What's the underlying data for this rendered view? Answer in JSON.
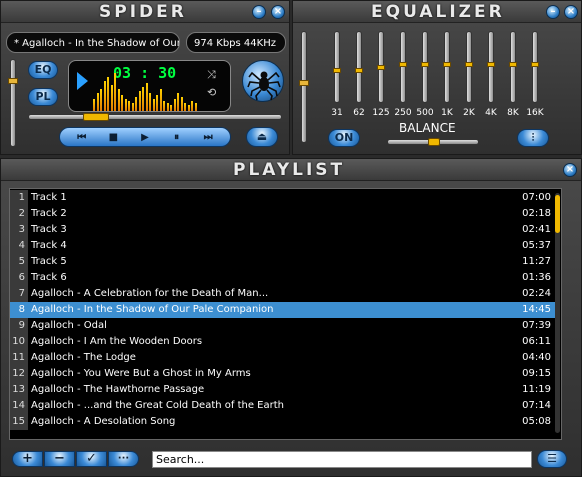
{
  "player": {
    "title": "SPIDER",
    "track_text": "* Agalloch - In the Shadow of Our",
    "bitrate": "974 Kbps 44KHz",
    "time": "03 : 30",
    "eq_button": "EQ",
    "pl_button": "PL",
    "seek_progress": 0.24,
    "volume_level": 0.78,
    "transport": {
      "prev": "⏮",
      "stop": "■",
      "play": "▶",
      "pause": "⏸",
      "next": "⏭",
      "eject": "⏏"
    },
    "spectrum": [
      12,
      18,
      22,
      30,
      34,
      26,
      38,
      22,
      16,
      12,
      10,
      8,
      14,
      20,
      24,
      28,
      18,
      12,
      16,
      22,
      10,
      8,
      6,
      12,
      18,
      14,
      8,
      6,
      10,
      8
    ]
  },
  "equalizer": {
    "title": "EQUALIZER",
    "preamp_level": 0.55,
    "bands": [
      {
        "label": "31",
        "level": 0.45
      },
      {
        "label": "62",
        "level": 0.45
      },
      {
        "label": "125",
        "level": 0.5
      },
      {
        "label": "250",
        "level": 0.55
      },
      {
        "label": "500",
        "level": 0.55
      },
      {
        "label": "1K",
        "level": 0.55
      },
      {
        "label": "2K",
        "level": 0.55
      },
      {
        "label": "4K",
        "level": 0.55
      },
      {
        "label": "8K",
        "level": 0.55
      },
      {
        "label": "16K",
        "level": 0.55
      }
    ],
    "on_label": "ON",
    "balance_label": "BALANCE",
    "balance_level": 0.5
  },
  "playlist": {
    "title": "PLAYLIST",
    "selected_index": 7,
    "tracks": [
      {
        "num": "1",
        "name": "Track 1",
        "time": "07:00"
      },
      {
        "num": "2",
        "name": "Track 2",
        "time": "02:18"
      },
      {
        "num": "3",
        "name": "Track 3",
        "time": "02:41"
      },
      {
        "num": "4",
        "name": "Track 4",
        "time": "05:37"
      },
      {
        "num": "5",
        "name": "Track 5",
        "time": "11:27"
      },
      {
        "num": "6",
        "name": "Track 6",
        "time": "01:36"
      },
      {
        "num": "7",
        "name": "Agalloch - A Celebration for the Death of Man...",
        "time": "02:24"
      },
      {
        "num": "8",
        "name": "Agalloch - In the Shadow of Our Pale Companion",
        "time": "14:45"
      },
      {
        "num": "9",
        "name": "Agalloch - Odal",
        "time": "07:39"
      },
      {
        "num": "10",
        "name": "Agalloch - I Am the Wooden Doors",
        "time": "06:11"
      },
      {
        "num": "11",
        "name": "Agalloch - The Lodge",
        "time": "04:40"
      },
      {
        "num": "12",
        "name": "Agalloch - You Were But a Ghost in My Arms",
        "time": "09:15"
      },
      {
        "num": "13",
        "name": "Agalloch - The Hawthorne Passage",
        "time": "11:19"
      },
      {
        "num": "14",
        "name": "Agalloch - ...and the Great Cold Death of the Earth",
        "time": "07:14"
      },
      {
        "num": "15",
        "name": "Agalloch - A Desolation Song",
        "time": "05:08"
      }
    ],
    "add": "+",
    "remove": "−",
    "check": "✓",
    "more": "···",
    "search_value": "Search..."
  }
}
